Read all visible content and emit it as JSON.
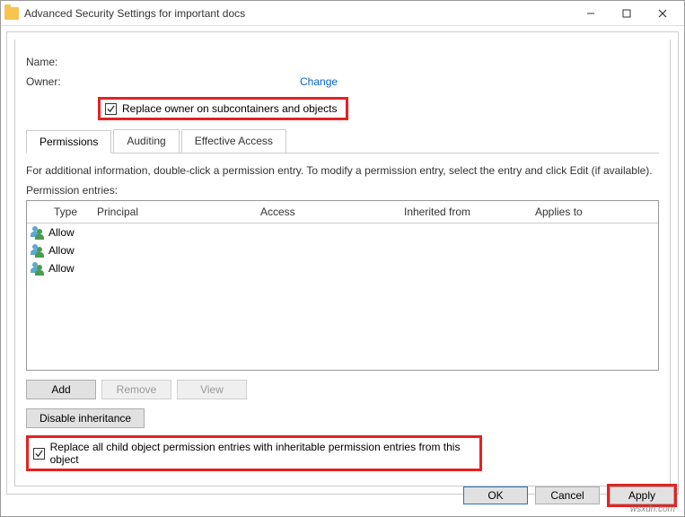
{
  "window": {
    "title": "Advanced Security Settings for important docs"
  },
  "fields": {
    "name_label": "Name:",
    "owner_label": "Owner:",
    "change_link": "Change",
    "replace_owner_label": "Replace owner on subcontainers and objects"
  },
  "tabs": {
    "permissions": "Permissions",
    "auditing": "Auditing",
    "effective": "Effective Access"
  },
  "info": "For additional information, double-click a permission entry. To modify a permission entry, select the entry and click Edit (if available).",
  "entries_label": "Permission entries:",
  "grid_headers": {
    "type": "Type",
    "principal": "Principal",
    "access": "Access",
    "inherited": "Inherited from",
    "applies": "Applies to"
  },
  "grid_rows": [
    {
      "type": "Allow"
    },
    {
      "type": "Allow"
    },
    {
      "type": "Allow"
    }
  ],
  "buttons": {
    "add": "Add",
    "remove": "Remove",
    "view": "View",
    "disable_inheritance": "Disable inheritance",
    "replace_child": "Replace all child object permission entries with inheritable permission entries from this object",
    "ok": "OK",
    "cancel": "Cancel",
    "apply": "Apply"
  },
  "watermark": "wsxdn.com"
}
